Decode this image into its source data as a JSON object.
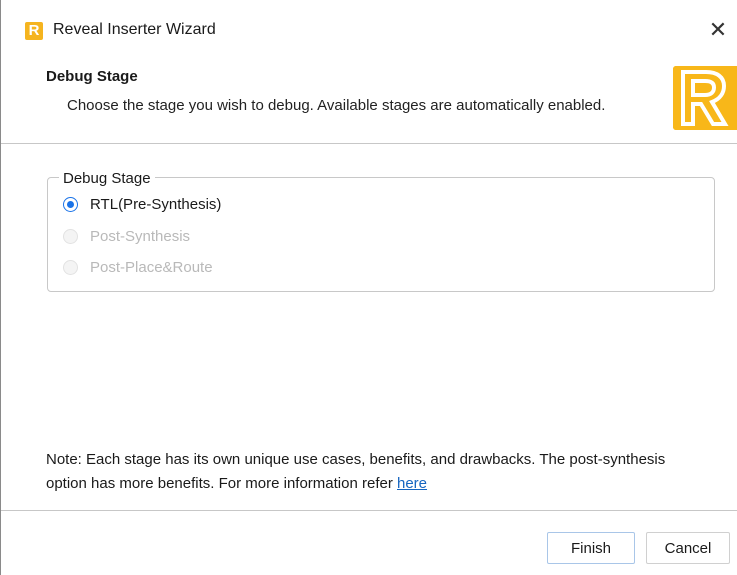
{
  "window": {
    "title": "Reveal Inserter Wizard",
    "app_icon": "reveal-logo-icon",
    "app_icon_letter": "R",
    "close_glyph": "✕"
  },
  "header": {
    "title": "Debug Stage",
    "description": "Choose the stage you wish to debug. Available stages are automatically enabled."
  },
  "group": {
    "legend": "Debug Stage",
    "options": [
      {
        "label": "RTL(Pre-Synthesis)",
        "checked": true,
        "enabled": true
      },
      {
        "label": "Post-Synthesis",
        "checked": false,
        "enabled": false
      },
      {
        "label": "Post-Place&Route",
        "checked": false,
        "enabled": false
      }
    ]
  },
  "note": {
    "text": "Note: Each stage has its own unique use cases, benefits, and drawbacks. The post-synthesis option has more benefits. For more information refer ",
    "link": "here"
  },
  "buttons": {
    "finish": "Finish",
    "cancel": "Cancel"
  },
  "colors": {
    "brand": "#f8b719",
    "accent": "#1a73e8",
    "link": "#1565c0",
    "disabled_text": "#b9b9b9"
  }
}
